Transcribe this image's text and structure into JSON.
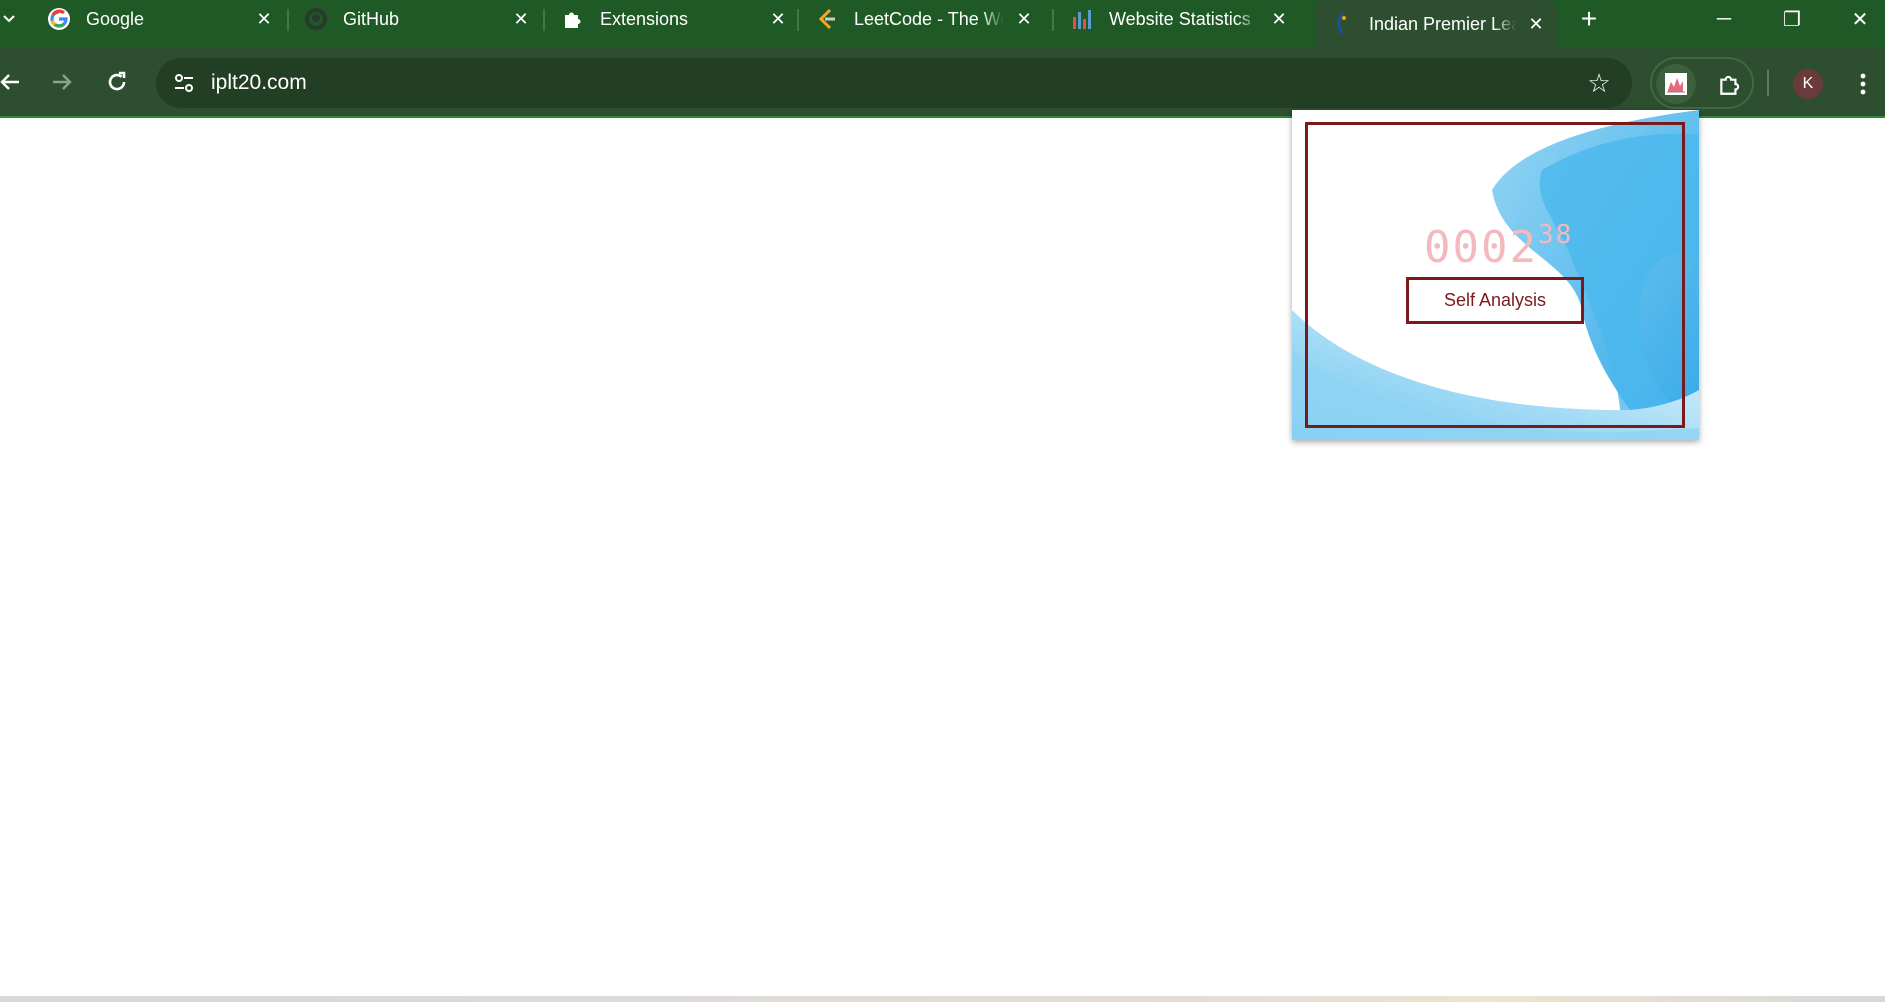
{
  "browser": {
    "tabs": [
      {
        "title": "Google",
        "favicon": "google-icon"
      },
      {
        "title": "GitHub",
        "favicon": "github-icon"
      },
      {
        "title": "Extensions",
        "favicon": "puzzle-icon"
      },
      {
        "title": "LeetCode - The World's Leading Online Programming Learning Platform",
        "favicon": "leetcode-icon"
      },
      {
        "title": "Website Statistics",
        "favicon": "stats-icon"
      },
      {
        "title": "Indian Premier League",
        "favicon": "ipl-icon",
        "active": true
      }
    ],
    "new_tab_label": "+",
    "window_controls": {
      "minimize": "─",
      "restore": "❐",
      "close": "✕"
    },
    "address": "iplt20.com",
    "profile_initial": "K"
  },
  "popup": {
    "timer_main": "0002",
    "timer_seconds": "38",
    "button_label": "Self Analysis"
  },
  "colors": {
    "tabstrip": "#1f5a26",
    "toolbar": "#2d4f2f",
    "accent_frame": "#7b1a1a",
    "timer": "#f3b9bf"
  }
}
